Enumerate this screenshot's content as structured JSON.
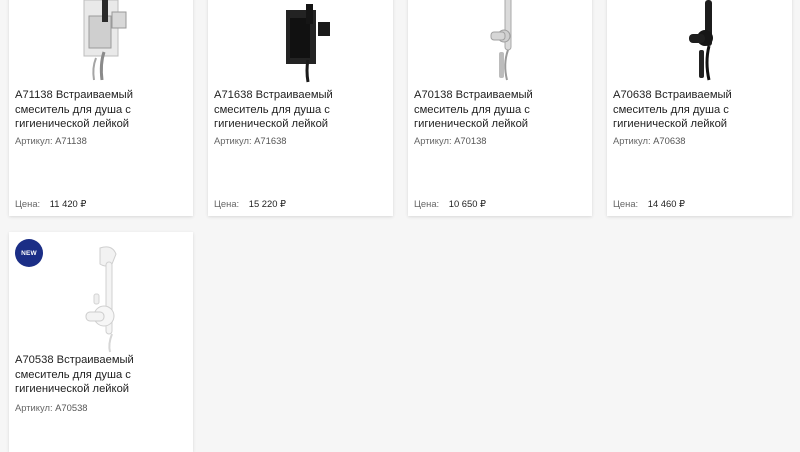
{
  "products": [
    {
      "title": "A71138 Встраиваемый смеситель для душа с гигиенической лейкой",
      "sku_label": "Артикул:",
      "sku": "A71138",
      "price_label": "Цена:",
      "price": "11 420 ₽",
      "finish": "chrome-square",
      "badge": ""
    },
    {
      "title": "A71638 Встраиваемый смеситель для душа с гигиенической лейкой",
      "sku_label": "Артикул:",
      "sku": "A71638",
      "price_label": "Цена:",
      "price": "15 220 ₽",
      "finish": "black-square",
      "badge": ""
    },
    {
      "title": "A70138 Встраиваемый смеситель для душа с гигиенической лейкой",
      "sku_label": "Артикул:",
      "sku": "A70138",
      "price_label": "Цена:",
      "price": "10 650 ₽",
      "finish": "chrome-round",
      "badge": ""
    },
    {
      "title": "A70638 Встраиваемый смеситель для душа с гигиенической лейкой",
      "sku_label": "Артикул:",
      "sku": "A70638",
      "price_label": "Цена:",
      "price": "14 460 ₽",
      "finish": "black-round",
      "badge": ""
    },
    {
      "title": "A70538 Встраиваемый смеситель для душа с гигиенической лейкой",
      "sku_label": "Артикул:",
      "sku": "A70538",
      "price_label": "",
      "price": "",
      "finish": "white-round",
      "badge": "NEW"
    }
  ],
  "colors": {
    "badge": "#1b2e86",
    "card_bg": "#ffffff",
    "page_bg": "#f6f6f6"
  }
}
